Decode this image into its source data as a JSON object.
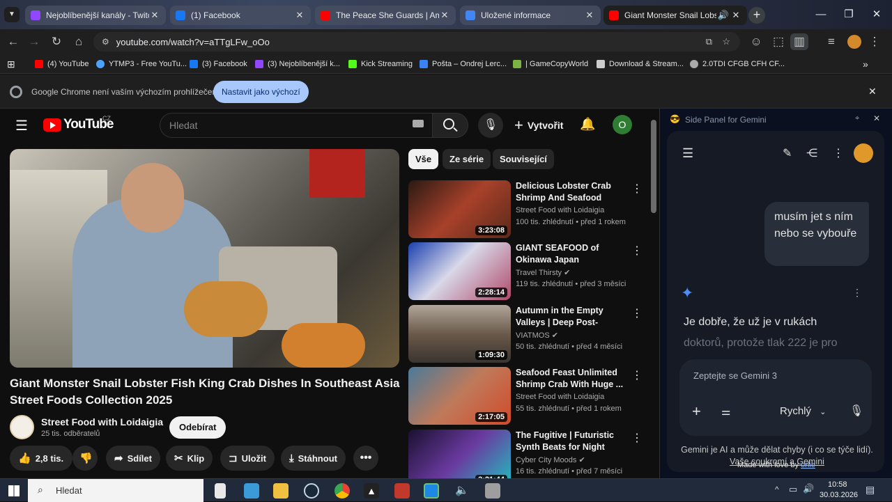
{
  "browser": {
    "tabs": [
      {
        "title": "Nejoblíbenější kanály - Twitch",
        "icon": "twitch-icon",
        "color": "#9146ff"
      },
      {
        "title": "(1) Facebook",
        "icon": "facebook-icon",
        "color": "#1877f2"
      },
      {
        "title": "The Peace She Guards | Ambien",
        "icon": "youtube-icon",
        "color": "#ff0000"
      },
      {
        "title": "Uložené informace",
        "icon": "google-icon",
        "color": "#4285f4"
      },
      {
        "title": "Giant Monster Snail Lobste",
        "icon": "youtube-icon",
        "color": "#ff0000"
      }
    ],
    "url": "youtube.com/watch?v=aTTgLFw_oOo",
    "bookmarks": [
      {
        "label": "(4) YouTube",
        "color": "#ff0000"
      },
      {
        "label": "YTMP3 - Free YouTu...",
        "color": "#4aa3ff"
      },
      {
        "label": "(3) Facebook",
        "color": "#1877f2"
      },
      {
        "label": "(3) Nejoblíbenější k...",
        "color": "#9146ff"
      },
      {
        "label": "Kick Streaming",
        "color": "#53fc18"
      },
      {
        "label": "Pošta – Ondrej Lerc...",
        "color": "#3b82f6"
      },
      {
        "label": "| GameCopyWorld",
        "color": "#7cb342"
      },
      {
        "label": "Download & Stream...",
        "color": "#cccccc"
      },
      {
        "label": "2.0TDI CFGB CFH CF...",
        "color": "#aaaaaa"
      }
    ],
    "infobar": {
      "message": "Google Chrome není vaším výchozím prohlížečem",
      "button": "Nastavit jako výchozí"
    }
  },
  "youtube": {
    "logo": "YouTube",
    "region": "CZ",
    "search_placeholder": "Hledat",
    "create_label": "Vytvořit",
    "avatar_letter": "O",
    "video_title": "Giant Monster Snail Lobster Fish King Crab Dishes In Southeast Asia Street Foods Collection 2025",
    "channel": "Street Food with Loidaigia",
    "subscribers": "25 tis. odběratelů",
    "subscribe_label": "Odebírat",
    "likes": "2,8 tis.",
    "actions": {
      "share": "Sdílet",
      "clip": "Klip",
      "save": "Uložit",
      "download": "Stáhnout"
    },
    "chips": [
      "Vše",
      "Ze série",
      "Související"
    ],
    "recommendations": [
      {
        "title": "Delicious Lobster Crab Shrimp And Seafood Dishe...",
        "channel": "Street Food with Loidaigia",
        "verified": false,
        "meta": "100 tis. zhlédnutí • před 1 rokem",
        "duration": "3:23:08",
        "thumb_color": "#7a3a2a"
      },
      {
        "title": "GIANT SEAFOOD of Okinawa Japan",
        "channel": "Travel Thirsty",
        "verified": true,
        "meta": "119 tis. zhlédnutí • před 3 měsíci",
        "duration": "2:28:14",
        "thumb_color": "#3a5fb0"
      },
      {
        "title": "Autumn in the Empty Valleys | Deep Post-Apocalyptic ...",
        "channel": "VIATMOS",
        "verified": true,
        "meta": "50 tis. zhlédnutí • před 4 měsíci",
        "duration": "1:09:30",
        "thumb_color": "#6a5a4a"
      },
      {
        "title": "Seafood Feast Unlimited Shrimp Crab With Huge ...",
        "channel": "Street Food with Loidaigia",
        "verified": false,
        "meta": "55 tis. zhlédnutí • před 1 rokem",
        "duration": "2:17:05",
        "thumb_color": "#a06a4a"
      },
      {
        "title": "The Fugitive | Futuristic Synth Beats for Night Drive...",
        "channel": "Cyber City Moods",
        "verified": true,
        "meta": "16 tis. zhlédnutí • před 7 měsíci",
        "duration": "3:21:44",
        "thumb_color": "#3a2a5a"
      }
    ]
  },
  "gemini": {
    "header": "Side Panel for Gemini",
    "user_message": "musím jet s ním nebo se vybouře",
    "response": "Je dobře, že už je v rukách",
    "response_faded": "doktorů, protože tlak 222 je pro",
    "input_placeholder": "Zeptejte se Gemini 3",
    "mode": "Rychlý",
    "disclaimer": "Gemini je AI a může dělat chyby (i co se týče lidí).",
    "privacy_link": "Vaše soukromí a Gemini",
    "made_with": "Made with love by",
    "made_by": "orlie"
  },
  "taskbar": {
    "search": "Hledat",
    "time": "10:58",
    "date": "30.03.2026"
  }
}
